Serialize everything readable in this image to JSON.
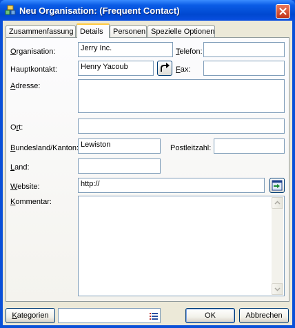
{
  "window": {
    "title": "Neu Organisation:  (Frequent Contact)",
    "icon": "organisation-icon",
    "close_icon": "close-icon"
  },
  "tabs": [
    {
      "label": "Zusammenfassung",
      "active": false
    },
    {
      "label": "Details",
      "active": true
    },
    {
      "label": "Personen",
      "active": false
    },
    {
      "label": "Spezielle Optionen",
      "active": false
    }
  ],
  "form": {
    "organisation": {
      "label_u": "O",
      "label_rest": "rganisation:",
      "value": "Jerry Inc."
    },
    "telefon": {
      "label_u": "T",
      "label_rest": "elefon:",
      "value": ""
    },
    "hauptkontakt": {
      "label": "Hauptkontakt:",
      "value": "Henry Yacoub",
      "button_icon": "go-to-contact-icon"
    },
    "fax": {
      "label_u": "F",
      "label_rest": "ax:",
      "value": ""
    },
    "adresse": {
      "label_u": "A",
      "label_rest": "dresse:",
      "value": ""
    },
    "ort": {
      "label_pre": "O",
      "label_u": "r",
      "label_rest": "t:",
      "value": ""
    },
    "bundesland": {
      "label_u": "B",
      "label_rest": "undesland/Kanton:",
      "value": "Lewiston"
    },
    "postleitzahl": {
      "label": "Postleitzahl:",
      "value": ""
    },
    "land": {
      "label_u": "L",
      "label_rest": "and:",
      "value": ""
    },
    "website": {
      "label_u": "W",
      "label_rest": "ebsite:",
      "value": "http://",
      "button_icon": "open-website-icon"
    },
    "kommentar": {
      "label_u": "K",
      "label_rest": "ommentar:",
      "value": ""
    }
  },
  "footer": {
    "kategorien_u": "K",
    "kategorien_rest": "ategorien",
    "category_value": "",
    "category_icon": "list-icon",
    "ok_label": "OK",
    "cancel_label": "Abbrechen"
  }
}
